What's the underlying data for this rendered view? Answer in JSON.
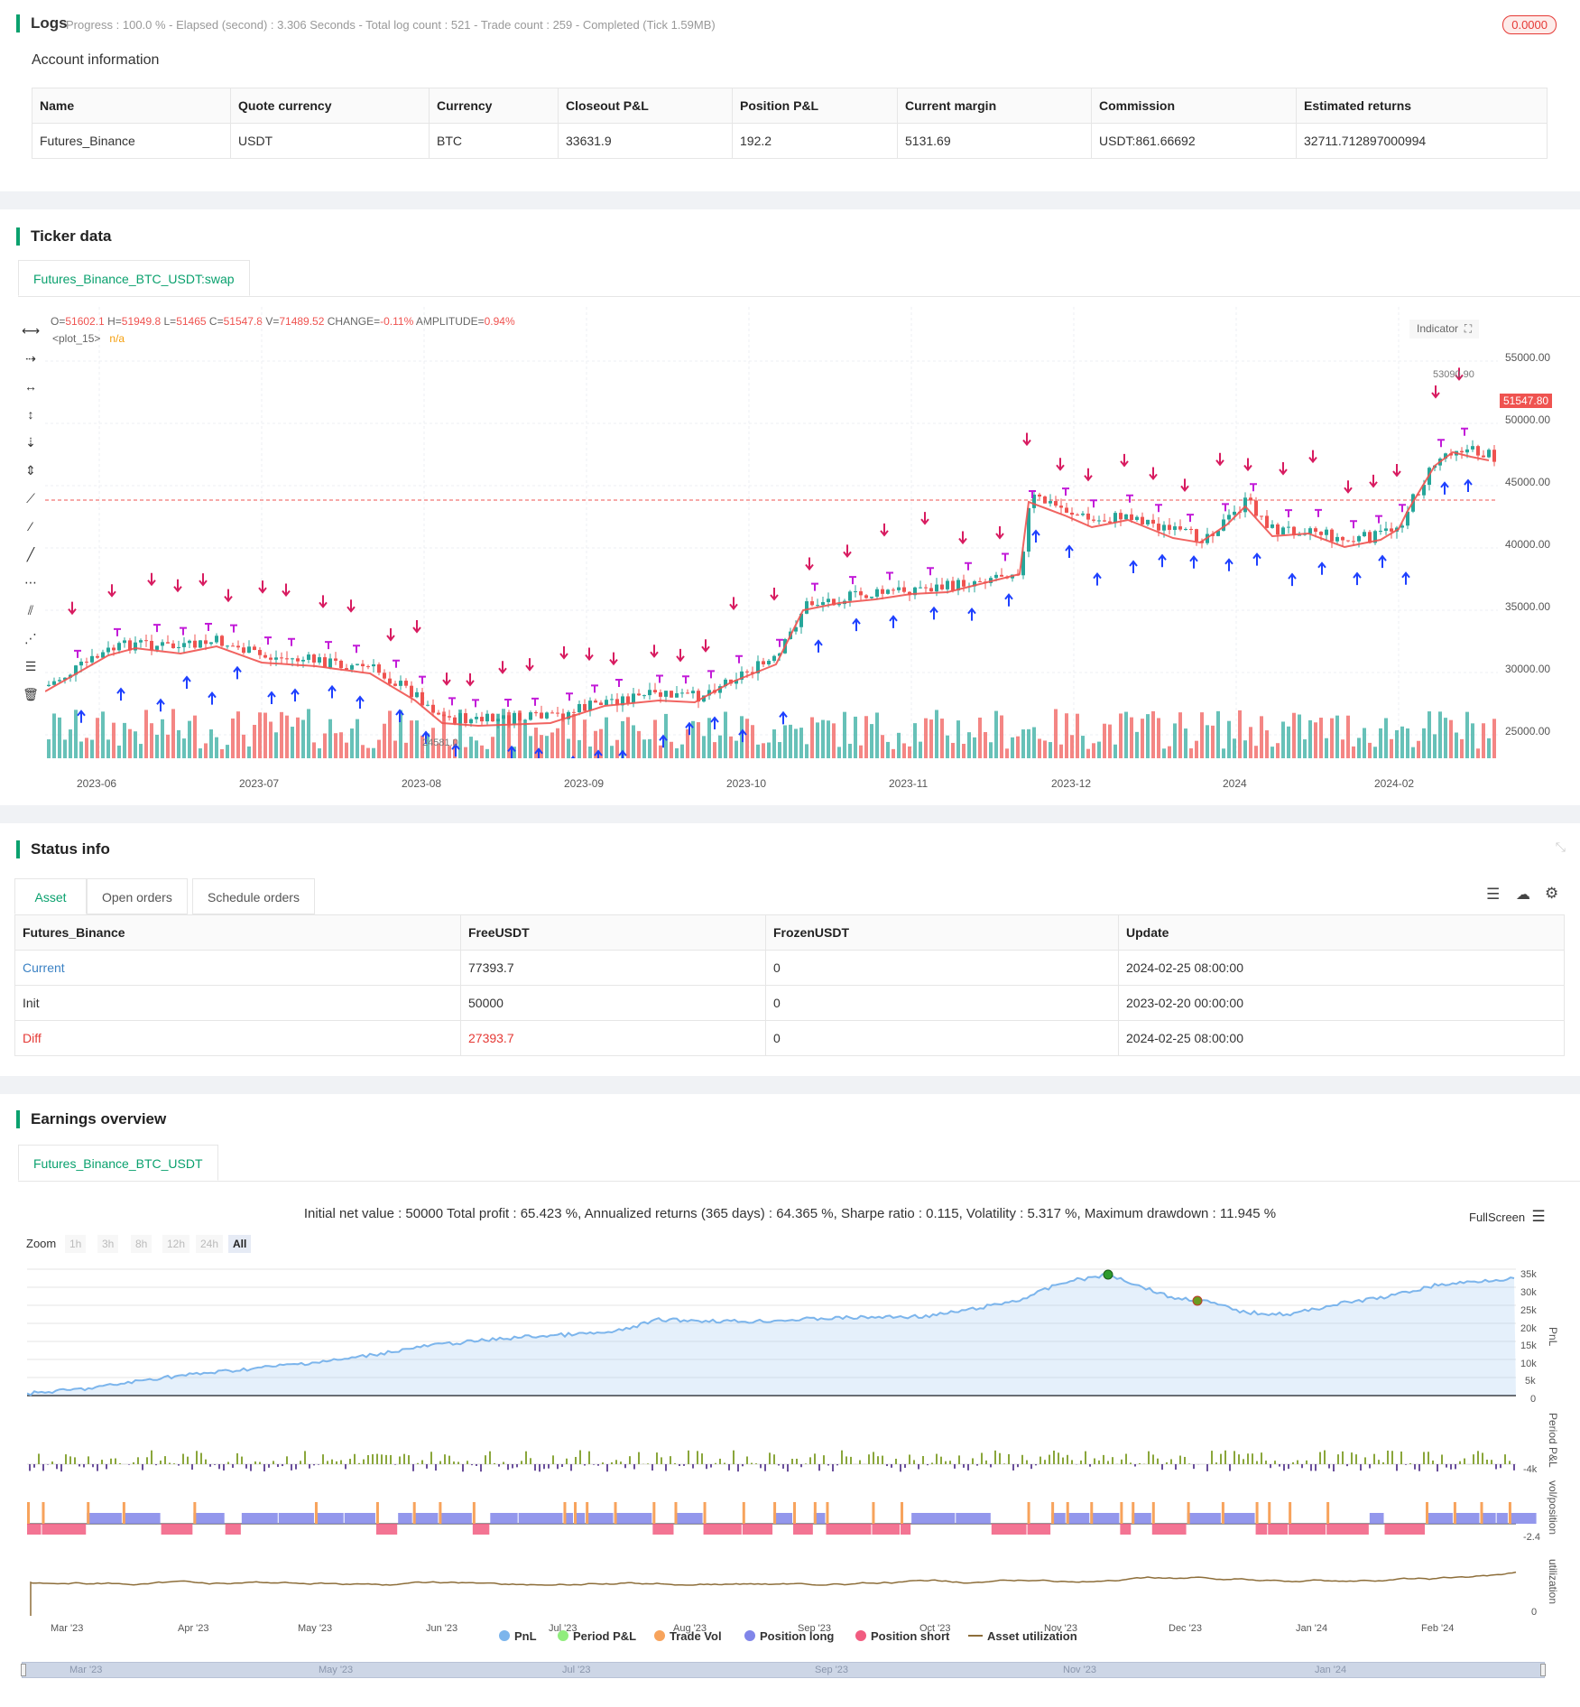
{
  "logs": {
    "title": "Logs",
    "status": "Progress : 100.0 % - Elapsed (second) : 3.306  Seconds - Total log count : 521 - Trade count : 259 - Completed (Tick 1.59MB)",
    "badge": "0.0000"
  },
  "account": {
    "title": "Account information",
    "headers": [
      "Name",
      "Quote currency",
      "Currency",
      "Closeout P&L",
      "Position P&L",
      "Current margin",
      "Commission",
      "Estimated returns"
    ],
    "row": [
      "Futures_Binance",
      "USDT",
      "BTC",
      "33631.9",
      "192.2",
      "5131.69",
      "USDT:861.66692",
      "32711.712897000994"
    ]
  },
  "ticker": {
    "title": "Ticker data",
    "tab": "Futures_Binance_BTC_USDT:swap",
    "ohlc": {
      "o_label": "O=",
      "o": "51602.1",
      "h_label": "H=",
      "h": "51949.8",
      "l_label": "L=",
      "l": "51465",
      "c_label": "C=",
      "c": "51547.8",
      "v_label": "V=",
      "v": "71489.52",
      "change_label": "CHANGE=",
      "change": "-0.11%",
      "amp_label": "AMPLITUDE=",
      "amp": "0.94%"
    },
    "plot_label": "<plot_15>",
    "plot_value": "n/a",
    "indicator_btn": "Indicator",
    "price_tag": "51547.80",
    "peak_label": "53090.90",
    "low_label": "24581.0",
    "y_ticks": [
      "55000.00",
      "50000.00",
      "45000.00",
      "40000.00",
      "35000.00",
      "30000.00",
      "25000.00"
    ],
    "x_ticks": [
      "2023-06",
      "2023-07",
      "2023-08",
      "2023-09",
      "2023-10",
      "2023-11",
      "2023-12",
      "2024",
      "2024-02"
    ],
    "colors": {
      "up": "#26a69a",
      "down": "#ef5350",
      "short": "#d81b60",
      "long": "#1e40ff",
      "close": "#c21bd8"
    }
  },
  "status": {
    "title": "Status info",
    "tabs": [
      "Asset",
      "Open orders",
      "Schedule orders"
    ],
    "headers": [
      "Futures_Binance",
      "FreeUSDT",
      "FrozenUSDT",
      "Update"
    ],
    "rows": [
      [
        "Current",
        "77393.7",
        "0",
        "2024-02-25 08:00:00"
      ],
      [
        "Init",
        "50000",
        "0",
        "2023-02-20 00:00:00"
      ],
      [
        "Diff",
        "27393.7",
        "0",
        "2024-02-25 08:00:00"
      ]
    ]
  },
  "earnings": {
    "title": "Earnings overview",
    "tab": "Futures_Binance_BTC_USDT",
    "summary": "Initial net value : 50000  Total profit : 65.423 %, Annualized returns (365 days) : 64.365 %, Sharpe ratio : 0.115, Volatility : 5.317 %, Maximum drawdown : 11.945 %",
    "fullscreen": "FullScreen",
    "zoom_label": "Zoom",
    "zoom_opts": [
      "1h",
      "3h",
      "8h",
      "12h",
      "24h",
      "All"
    ],
    "pnl_ticks": [
      "35k",
      "30k",
      "25k",
      "20k",
      "15k",
      "10k",
      "5k",
      "0"
    ],
    "pnl_axis": "PnL",
    "period_axis": "Period P&L",
    "period_tick": "-4k",
    "pos_axis": "vol/position",
    "pos_tick": "-2.4",
    "util_axis": "utilization",
    "util_tick": "0",
    "x_ticks": [
      "Mar '23",
      "Apr '23",
      "May '23",
      "Jun '23",
      "Jul '23",
      "Aug '23",
      "Sep '23",
      "Oct '23",
      "Nov '23",
      "Dec '23",
      "Jan '24",
      "Feb '24"
    ],
    "nav_ticks": [
      "Mar '23",
      "May '23",
      "Jul '23",
      "Sep '23",
      "Nov '23",
      "Jan '24"
    ],
    "legend": [
      "PnL",
      "Period P&L",
      "Trade Vol",
      "Position long",
      "Position short",
      "Asset utilization"
    ],
    "legend_colors": [
      "#7cb5ec",
      "#90ed7d",
      "#f7a35c",
      "#8085e9",
      "#f15c80",
      "#8d6e3a"
    ]
  }
}
